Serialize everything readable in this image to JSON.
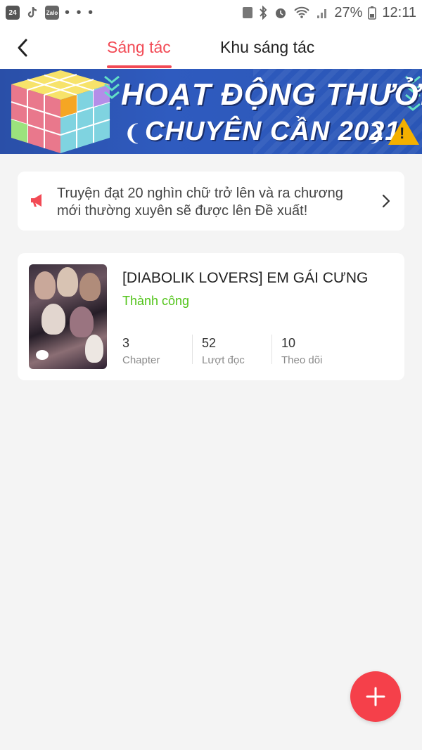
{
  "status_bar": {
    "left_icons": [
      "app-24h-icon",
      "tiktok-icon",
      "zalo-icon"
    ],
    "zalo_label": "Zalo",
    "app_24h_label": "24",
    "more": "• • •",
    "battery": "27%",
    "time": "12:11"
  },
  "header": {
    "tabs": [
      {
        "label": "Sáng tác",
        "active": true
      },
      {
        "label": "Khu sáng tác",
        "active": false
      }
    ]
  },
  "banner": {
    "title": "HOẠT ĐỘNG THƯỞNG",
    "subtitle": "CHUYÊN CẦN 2021",
    "warning_mark": "!",
    "slides": 5,
    "active_slide": 1
  },
  "notice": {
    "text": "Truyện đạt 20 nghìn chữ trở lên và ra chương mới thường xuyên sẽ được lên Đề xuất!"
  },
  "story": {
    "title": "[DIABOLIK LOVERS] EM GÁI CƯNG",
    "status": "Thành công",
    "stats": [
      {
        "value": "3",
        "label": "Chapter"
      },
      {
        "value": "52",
        "label": "Lượt đọc"
      },
      {
        "value": "10",
        "label": "Theo dõi"
      }
    ]
  },
  "colors": {
    "accent": "#f24a55",
    "success": "#52c41a",
    "fab": "#f5404a",
    "banner_blue": "#2f5bbf"
  },
  "fab": {
    "icon": "plus-icon"
  }
}
